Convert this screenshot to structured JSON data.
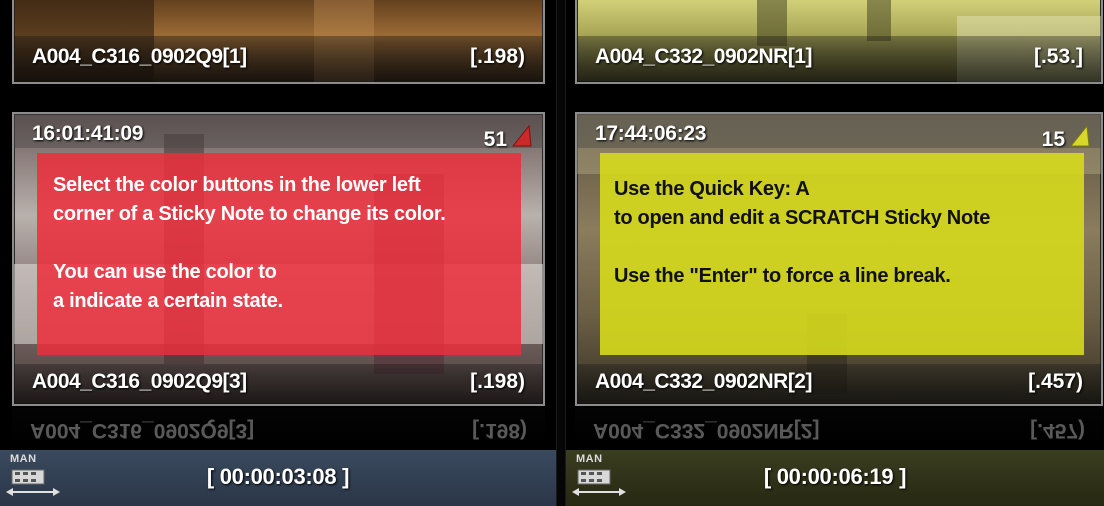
{
  "left_column": {
    "top_clip": {
      "name": "A004_C316_0902Q9[1]",
      "fraction": "[.198)"
    },
    "main_clip": {
      "timecode": "16:01:41:09",
      "count": "51",
      "flag_color": "#cc2a2a",
      "sticky_color": "#ec2e3c",
      "sticky_text": "Select the color buttons in the lower left\ncorner of a Sticky Note to change its color.\n\nYou can use the color to\na indicate a certain state.",
      "name": "A004_C316_0902Q9[3]",
      "fraction": "[.198)"
    },
    "reflection": {
      "name": "A004_C316_0902Q9[3]",
      "fraction": "[.198)"
    },
    "bottom_bar": {
      "mode_label": "MAN",
      "duration": "[ 00:00:03:08 ]"
    }
  },
  "right_column": {
    "top_clip": {
      "name": "A004_C332_0902NR[1]",
      "fraction": "[.53.]"
    },
    "main_clip": {
      "timecode": "17:44:06:23",
      "count": "15",
      "flag_color": "#d8d82a",
      "sticky_color": "#d6da1c",
      "sticky_text": "Use the Quick Key: A\nto open and edit a SCRATCH Sticky Note\n\nUse the \"Enter\" to force a line break.",
      "name": "A004_C332_0902NR[2]",
      "fraction": "[.457)"
    },
    "reflection": {
      "name": "A004_C332_0902NR[2]",
      "fraction": "[.457)"
    },
    "bottom_bar": {
      "mode_label": "MAN",
      "duration": "[ 00:00:06:19 ]"
    }
  }
}
